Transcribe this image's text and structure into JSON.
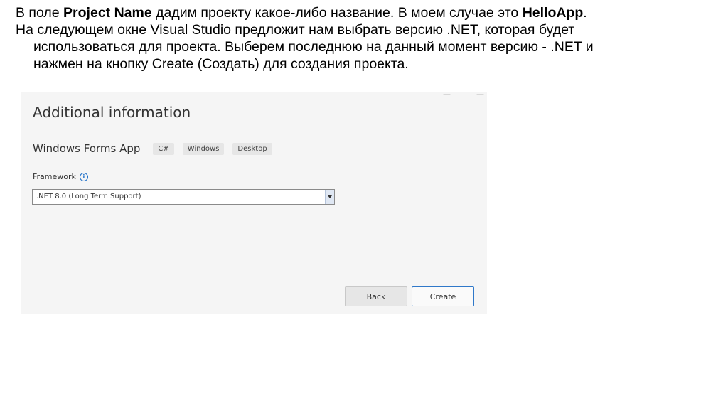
{
  "slide": {
    "line1": {
      "a": "В поле ",
      "b": "Project Name",
      "c": " дадим проекту какое-либо название. В моем случае это ",
      "d": "HelloApp",
      "e": "."
    },
    "line2": "На следующем окне Visual Studio предложит нам выбрать версию .NET, которая будет",
    "line3": "использоваться для проекта. Выберем последнюю на данный момент версию - .NET и",
    "line4": "нажмен на кнопку Create (Создать) для создания проекта."
  },
  "dialog": {
    "title": "Additional information",
    "project_type": "Windows Forms App",
    "tags": [
      "C#",
      "Windows",
      "Desktop"
    ],
    "framework_label": "Framework",
    "framework_value": ".NET 8.0 (Long Term Support)",
    "back_label": "Back",
    "create_label": "Create"
  },
  "icons": {
    "info": "info-icon",
    "dropdown": "chevron-down-icon"
  },
  "colors": {
    "accent": "#2f78c9",
    "dialog_bg": "#f5f5f5"
  }
}
